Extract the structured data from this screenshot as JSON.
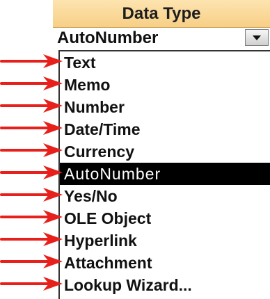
{
  "header": {
    "title": "Data Type"
  },
  "field": {
    "value": "AutoNumber",
    "dropdown_icon": "chevron-down-icon"
  },
  "list": {
    "selected_index": 5,
    "items": [
      {
        "label": "Text"
      },
      {
        "label": "Memo"
      },
      {
        "label": "Number"
      },
      {
        "label": "Date/Time"
      },
      {
        "label": "Currency"
      },
      {
        "label": "AutoNumber"
      },
      {
        "label": "Yes/No"
      },
      {
        "label": "OLE Object"
      },
      {
        "label": "Hyperlink"
      },
      {
        "label": "Attachment"
      },
      {
        "label": "Lookup Wizard..."
      }
    ]
  },
  "annotations": {
    "arrow_color": "#e8201b",
    "arrow_icon": "red-arrow-icon"
  }
}
